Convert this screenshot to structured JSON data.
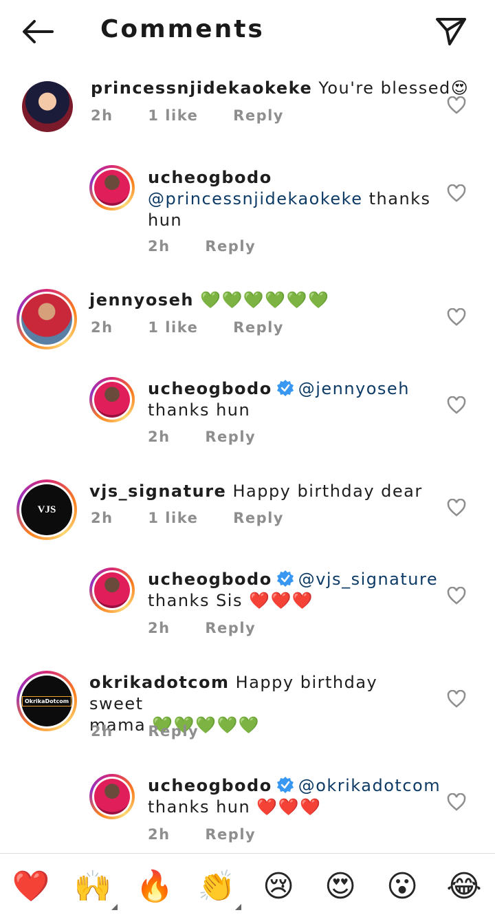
{
  "header": {
    "title": "Comments"
  },
  "comments": [
    {
      "username": "princessnjidekaokeke",
      "text": "You're blessed😍",
      "time": "2h",
      "likes": "1 like",
      "reply": "Reply"
    },
    {
      "username": "ucheogbodo",
      "mention": "@princessnjidekaokeke",
      "text1": " thanks",
      "text2": "hun",
      "time": "2h",
      "reply": "Reply"
    },
    {
      "username": "jennyoseh",
      "text": "💚💚💚💚💚💚",
      "time": "2h",
      "likes": "1 like",
      "reply": "Reply"
    },
    {
      "username": "ucheogbodo",
      "mention": "@jennyoseh",
      "text2": "thanks hun",
      "time": "2h",
      "reply": "Reply"
    },
    {
      "username": "vjs_signature",
      "text": "Happy birthday dear",
      "time": "2h",
      "likes": "1 like",
      "reply": "Reply",
      "avatar_text": "VJS"
    },
    {
      "username": "ucheogbodo",
      "mention": "@vjs_signature",
      "text2": "thanks Sis ❤️❤️❤️",
      "time": "2h",
      "reply": "Reply"
    },
    {
      "username": "okrikadotcom",
      "text": "Happy birthday sweet",
      "text2": "mama 💚💚💚💚💚",
      "time": "2h",
      "reply": "Reply",
      "avatar_text": "OkrikaDotcom"
    },
    {
      "username": "ucheogbodo",
      "mention": "@okrikadotcom",
      "text2": "thanks hun ❤️❤️❤️",
      "time": "2h",
      "reply": "Reply"
    }
  ],
  "reactions": [
    "❤️",
    "🙌",
    "🔥",
    "👏",
    "😢",
    "😍",
    "😮",
    "😂"
  ],
  "colors": {
    "mention": "#0d3b66",
    "verified": "#3897f0",
    "meta": "#8e8e8e",
    "heart_outline": "#8e8e8e"
  },
  "icons": {
    "back": "arrow-left-icon",
    "send": "paper-plane-icon",
    "like": "heart-outline-icon",
    "verified": "verified-badge-icon"
  }
}
